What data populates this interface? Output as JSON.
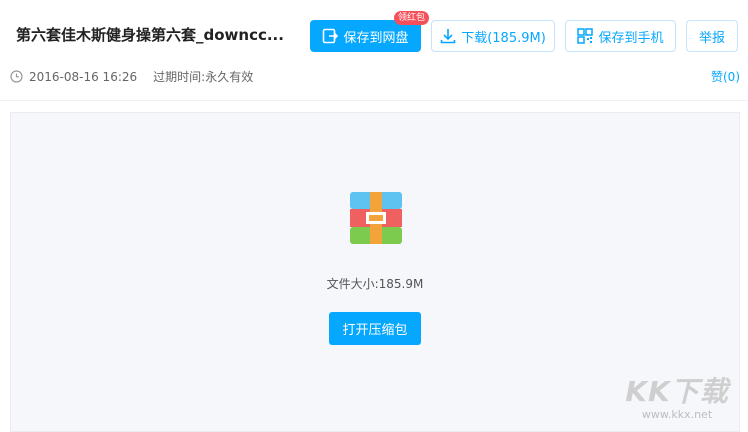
{
  "header": {
    "title": "第六套佳木斯健身操第六套_downcc...",
    "save_label": "保存到网盘",
    "badge": "领红包",
    "download_label": "下载(185.9M)",
    "phone_label": "保存到手机",
    "report_label": "举报"
  },
  "meta": {
    "date": "2016-08-16 16:26",
    "expire_label": "过期时间:",
    "expire_value": "永久有效",
    "like": "赞(0)"
  },
  "file": {
    "size_text": "文件大小:185.9M",
    "open_label": "打开压缩包"
  },
  "watermark": {
    "logo": "KK下载",
    "url": "www.kkx.net"
  },
  "colors": {
    "accent": "#06a7ff",
    "badge": "#f5505a"
  }
}
